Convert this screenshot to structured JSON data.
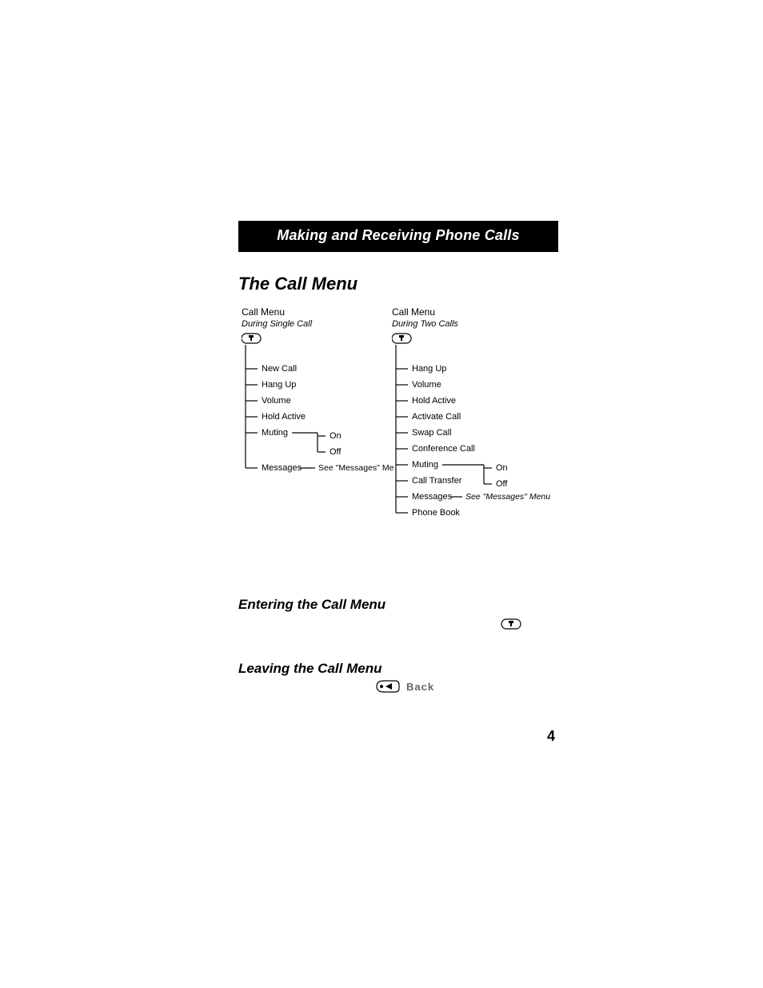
{
  "header": {
    "title": "Making and Receiving Phone Calls"
  },
  "sections": {
    "call_menu_title": "The Call Menu",
    "entering_title": "Entering the Call Menu",
    "leaving_title": "Leaving the Call Menu"
  },
  "tree_left": {
    "title": "Call Menu",
    "subtitle": "During Single Call",
    "items": {
      "i0": "New Call",
      "i1": "Hang Up",
      "i2": "Volume",
      "i3": "Hold Active",
      "i4": "Muting",
      "i5": "Messages"
    },
    "muting": {
      "on": "On",
      "off": "Off"
    },
    "messages_ref": "See \"Messages\" Menu"
  },
  "tree_right": {
    "title": "Call Menu",
    "subtitle": "During Two Calls",
    "items": {
      "i0": "Hang Up",
      "i1": "Volume",
      "i2": "Hold Active",
      "i3": "Activate Call",
      "i4": "Swap Call",
      "i5": "Conference Call",
      "i6": "Muting",
      "i7": "Call Transfer",
      "i8": "Messages",
      "i9": "Phone Book"
    },
    "muting": {
      "on": "On",
      "off": "Off"
    },
    "messages_ref": "See \"Messages\" Menu"
  },
  "back_label": "Back",
  "page_number": "4"
}
